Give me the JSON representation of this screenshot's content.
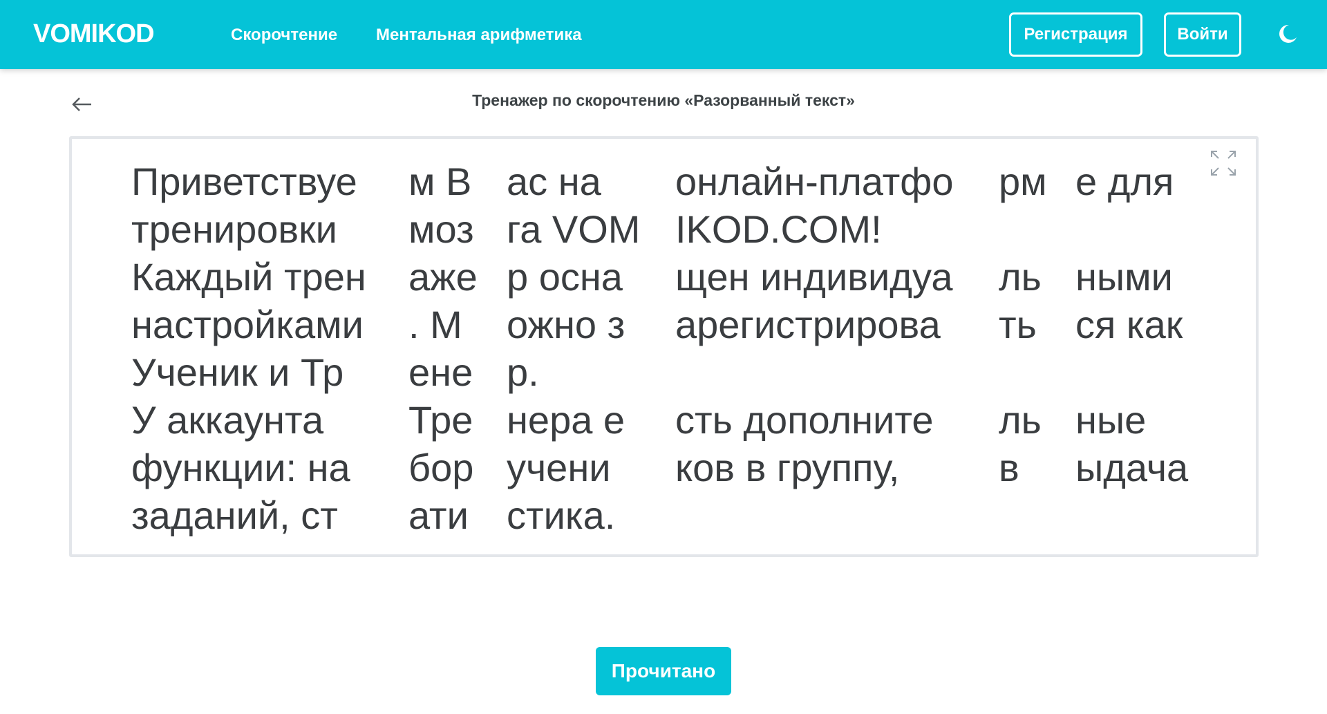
{
  "header": {
    "logo": "VOMIKOD",
    "nav": [
      "Скорочтение",
      "Ментальная арифметика"
    ],
    "register_label": "Регистрация",
    "login_label": "Войти",
    "theme_icon": "moon-icon"
  },
  "page": {
    "title": "Тренажер по скорочтению «Разорванный текст»",
    "back_icon": "arrow-left-icon",
    "expand_icon": "fullscreen-icon"
  },
  "text_rows": [
    [
      "Приветствуе",
      "м В",
      "ас на",
      "онлайн-платфо",
      "рм",
      "е для"
    ],
    [
      "тренировки",
      "моз",
      "га VOM",
      "IKOD.COM!",
      "",
      ""
    ],
    [
      "Каждый трен",
      "аже",
      "р осна",
      "щен индивидуа",
      "ль",
      "ными"
    ],
    [
      "настройками",
      ". М",
      "ожно з",
      "арегистрирова",
      "ть",
      "ся как"
    ],
    [
      "Ученик и Тр",
      "ене",
      "р.",
      "",
      "",
      ""
    ],
    [
      "У аккаунта",
      "Тре",
      "нера е",
      "сть дополните",
      "ль",
      "ные"
    ],
    [
      "функции: на",
      "бор",
      "учени",
      "ков в группу,",
      "в",
      "ыдача"
    ],
    [
      "заданий, ст",
      "ати",
      "стика.",
      "",
      "",
      ""
    ]
  ],
  "actions": {
    "read_label": "Прочитано"
  },
  "colors": {
    "accent": "#05c3d7",
    "text": "#3a3d40",
    "panel_border": "#e3e6ea"
  }
}
